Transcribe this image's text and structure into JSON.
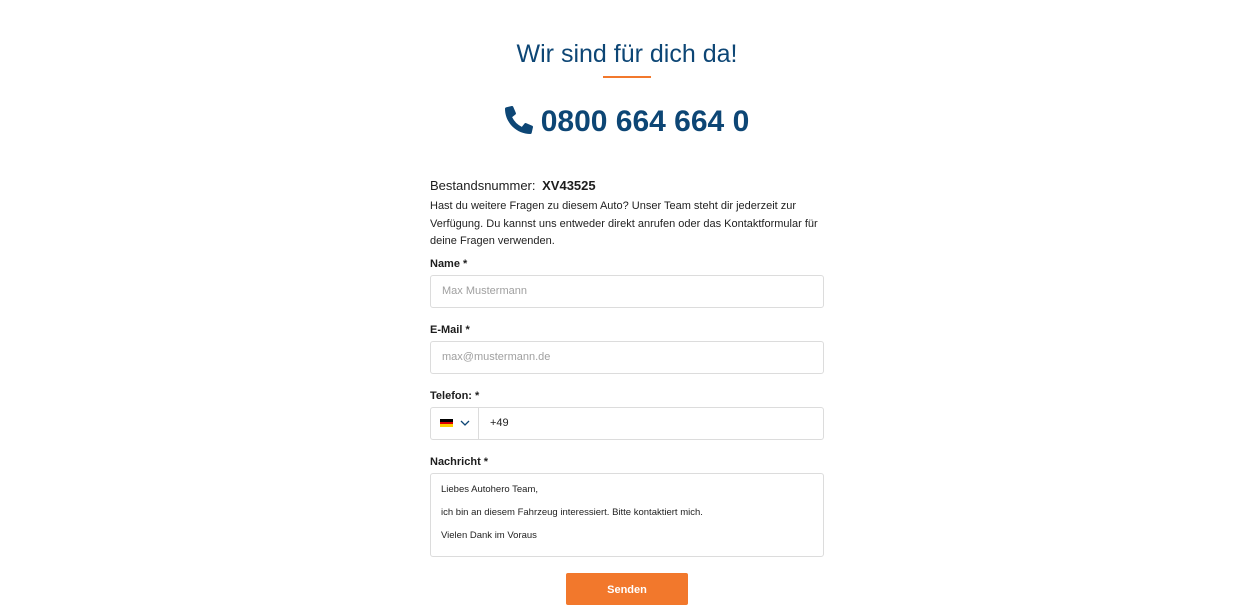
{
  "header": {
    "title": "Wir sind für dich da!",
    "phone": "0800 664 664 0"
  },
  "stock": {
    "label": "Bestandsnummer:",
    "number": "XV43525"
  },
  "intro": "Hast du weitere Fragen zu diesem Auto? Unser Team steht dir jederzeit zur Verfügung. Du kannst uns entweder direkt anrufen oder das Kontaktformular für deine Fragen verwenden.",
  "form": {
    "name_label": "Name *",
    "name_placeholder": "Max Mustermann",
    "email_label": "E-Mail *",
    "email_placeholder": "max@mustermann.de",
    "phone_label": "Telefon: *",
    "phone_country": "de-flag-icon",
    "phone_prefix": "+49",
    "message_label": "Nachricht *",
    "message_lines": [
      "Liebes Autohero Team,",
      "ich bin an diesem Fahrzeug interessiert. Bitte kontaktiert mich.",
      "Vielen Dank im Voraus"
    ],
    "submit_label": "Senden"
  },
  "colors": {
    "brand_blue": "#0d4675",
    "accent_orange": "#f2782c",
    "border": "#dcdcdc"
  }
}
